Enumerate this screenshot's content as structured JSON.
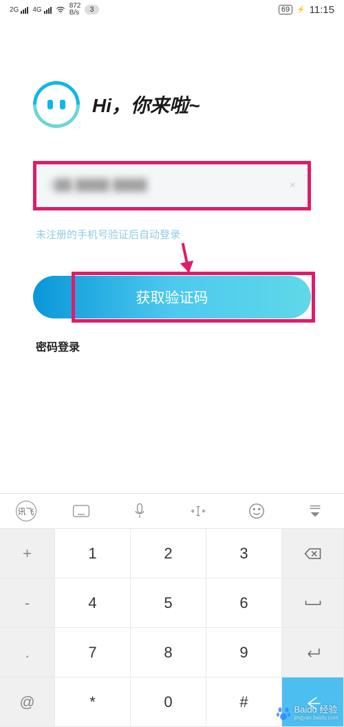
{
  "status": {
    "signal1_label": "2G",
    "signal2_label": "4G",
    "speed_value": "872",
    "speed_unit": "B/s",
    "notif_count": "3",
    "battery": "69",
    "time": "11:15"
  },
  "login": {
    "greeting": "Hi，你来啦~",
    "phone_masked": "1██ ████ ████",
    "hint": "未注册的手机号验证后自动登录",
    "get_code_btn": "获取验证码",
    "pwd_login": "密码登录"
  },
  "keyboard": {
    "toolbar_ime": "讯飞",
    "side_keys": [
      "+",
      "-",
      ".",
      "@"
    ],
    "num_rows": [
      [
        "1",
        "2",
        "3"
      ],
      [
        "4",
        "5",
        "6"
      ],
      [
        "7",
        "8",
        "9"
      ],
      [
        "*",
        "0",
        "#"
      ]
    ]
  },
  "watermark": {
    "brand": "Bai",
    "brand2": "du",
    "product": "经验",
    "url": "jingyan.baidu.com"
  }
}
